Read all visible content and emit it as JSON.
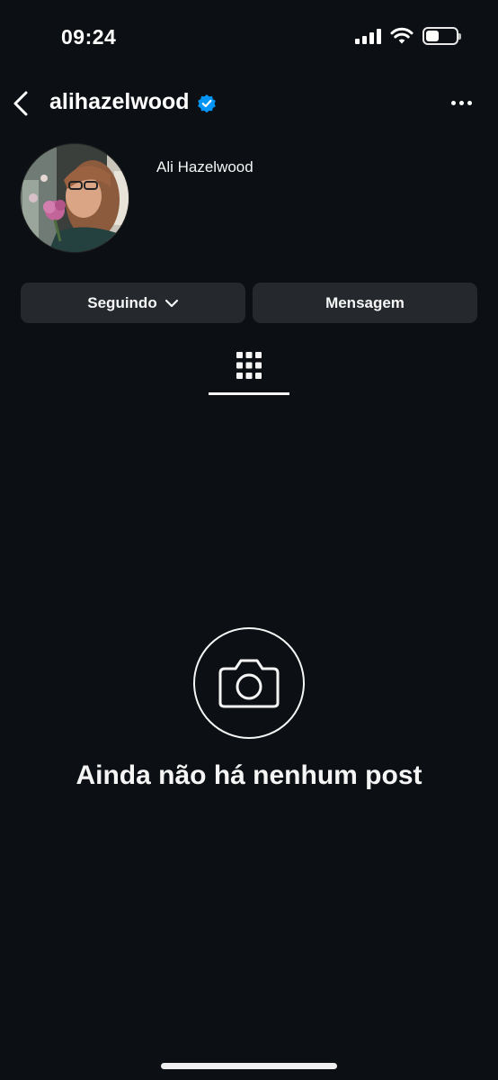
{
  "status_bar": {
    "time": "09:24",
    "icons": [
      "cellular-signal-icon",
      "wifi-icon",
      "battery-icon"
    ]
  },
  "header": {
    "back_icon": "chevron-left-icon",
    "username": "alihazelwood",
    "verified_icon": "verified-badge-icon",
    "more_icon": "more-horizontal-icon"
  },
  "profile": {
    "display_name": "Ali Hazelwood"
  },
  "actions": {
    "follow_label": "Seguindo",
    "follow_icon": "chevron-down-icon",
    "message_label": "Mensagem"
  },
  "tabs": {
    "active": "grid-icon"
  },
  "empty_state": {
    "icon": "camera-icon",
    "text": "Ainda não há nenhum post"
  },
  "colors": {
    "background": "#0c1014",
    "button": "#25292e",
    "verified": "#0095f6"
  }
}
